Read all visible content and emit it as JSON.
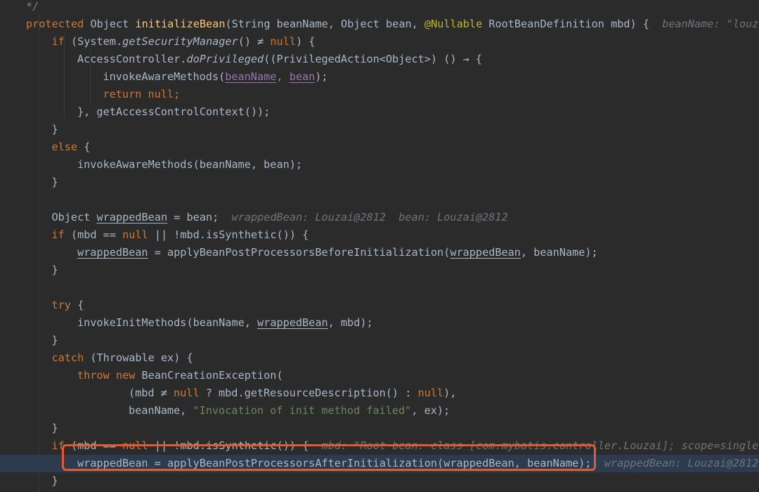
{
  "editor": {
    "lines": [
      {
        "indent": 0,
        "tokens": [
          {
            "t": "*/",
            "c": "cm"
          }
        ]
      },
      {
        "indent": 0,
        "tokens": [
          {
            "t": "protected ",
            "c": "kw"
          },
          {
            "t": "Object "
          },
          {
            "t": "initializeBean",
            "c": "fn"
          },
          {
            "t": "(String beanName, Object bean, "
          },
          {
            "t": "@Nullable",
            "c": "ann"
          },
          {
            "t": " RootBeanDefinition mbd) {  "
          },
          {
            "t": "beanName: \"louza",
            "c": "hint"
          }
        ]
      },
      {
        "indent": 1,
        "tokens": [
          {
            "t": "if ",
            "c": "kw"
          },
          {
            "t": "(System."
          },
          {
            "t": "getSecurityManager",
            "c": "it"
          },
          {
            "t": "() ≠ "
          },
          {
            "t": "null",
            "c": "kw"
          },
          {
            "t": ") {"
          }
        ]
      },
      {
        "indent": 2,
        "tokens": [
          {
            "t": "AccessController."
          },
          {
            "t": "doPrivileged",
            "c": "it"
          },
          {
            "t": "((PrivilegedAction<Object>) () → {"
          }
        ]
      },
      {
        "indent": 3,
        "tokens": [
          {
            "t": "invokeAwareMethods("
          },
          {
            "t": "beanName",
            "c": "p"
          },
          {
            "t": ", ",
            "c": "kw"
          },
          {
            "t": "bean",
            "c": "p"
          },
          {
            "t": ");"
          }
        ]
      },
      {
        "indent": 3,
        "tokens": [
          {
            "t": "return null;",
            "c": "kw"
          }
        ]
      },
      {
        "indent": 2,
        "tokens": [
          {
            "t": "}, getAccessControlContext());"
          }
        ]
      },
      {
        "indent": 1,
        "tokens": [
          {
            "t": "}"
          }
        ]
      },
      {
        "indent": 1,
        "tokens": [
          {
            "t": "else ",
            "c": "kw"
          },
          {
            "t": "{"
          }
        ]
      },
      {
        "indent": 2,
        "tokens": [
          {
            "t": "invokeAwareMethods(beanName, bean);"
          }
        ]
      },
      {
        "indent": 1,
        "tokens": [
          {
            "t": "}"
          }
        ]
      },
      {
        "indent": 0,
        "tokens": []
      },
      {
        "indent": 1,
        "tokens": [
          {
            "t": "Object "
          },
          {
            "t": "wrappedBean",
            "c": "u"
          },
          {
            "t": " = bean;  "
          },
          {
            "t": "wrappedBean: Louzai@2812  bean: Louzai@2812",
            "c": "hint"
          }
        ]
      },
      {
        "indent": 1,
        "tokens": [
          {
            "t": "if ",
            "c": "kw"
          },
          {
            "t": "(mbd == "
          },
          {
            "t": "null",
            "c": "kw"
          },
          {
            "t": " || !mbd.isSynthetic()) {"
          }
        ]
      },
      {
        "indent": 2,
        "tokens": [
          {
            "t": "wrappedBean",
            "c": "u"
          },
          {
            "t": " = applyBeanPostProcessorsBeforeInitialization("
          },
          {
            "t": "wrappedBean",
            "c": "u"
          },
          {
            "t": ", beanName);"
          }
        ]
      },
      {
        "indent": 1,
        "tokens": [
          {
            "t": "}"
          }
        ]
      },
      {
        "indent": 0,
        "tokens": []
      },
      {
        "indent": 1,
        "tokens": [
          {
            "t": "try ",
            "c": "kw"
          },
          {
            "t": "{"
          }
        ]
      },
      {
        "indent": 2,
        "tokens": [
          {
            "t": "invokeInitMethods(beanName, "
          },
          {
            "t": "wrappedBean",
            "c": "u"
          },
          {
            "t": ", mbd);"
          }
        ]
      },
      {
        "indent": 1,
        "tokens": [
          {
            "t": "}"
          }
        ]
      },
      {
        "indent": 1,
        "tokens": [
          {
            "t": "catch ",
            "c": "kw"
          },
          {
            "t": "(Throwable ex) {"
          }
        ]
      },
      {
        "indent": 2,
        "tokens": [
          {
            "t": "throw new ",
            "c": "kw"
          },
          {
            "t": "BeanCreationException("
          }
        ]
      },
      {
        "indent": 4,
        "tokens": [
          {
            "t": "(mbd ≠ "
          },
          {
            "t": "null",
            "c": "kw"
          },
          {
            "t": " ? mbd.getResourceDescription() : "
          },
          {
            "t": "null",
            "c": "kw"
          },
          {
            "t": "),"
          }
        ]
      },
      {
        "indent": 4,
        "tokens": [
          {
            "t": "beanName, "
          },
          {
            "t": "\"Invocation of init method failed\"",
            "c": "str"
          },
          {
            "t": ", ex);"
          }
        ]
      },
      {
        "indent": 1,
        "tokens": [
          {
            "t": "}"
          }
        ]
      },
      {
        "indent": 1,
        "tokens": [
          {
            "t": "if ",
            "c": "kw"
          },
          {
            "t": "(mbd == "
          },
          {
            "t": "null",
            "c": "kw"
          },
          {
            "t": " || !mbd.isSynthetic()) {  "
          },
          {
            "t": "mbd: \"Root bean: class [com.mybatis.controller.Louzai]; scope=singlet",
            "c": "hint"
          }
        ]
      },
      {
        "indent": 2,
        "highlight": true,
        "tokens": [
          {
            "t": "wrappedBean",
            "c": "u"
          },
          {
            "t": " = applyBeanPostProcessorsAfterInitialization("
          },
          {
            "t": "wrappedBean",
            "c": "u"
          },
          {
            "t": ", beanName);  "
          },
          {
            "t": "wrappedBean: Louzai@2812",
            "c": "hint"
          }
        ]
      },
      {
        "indent": 1,
        "tokens": [
          {
            "t": "}"
          }
        ]
      }
    ]
  }
}
